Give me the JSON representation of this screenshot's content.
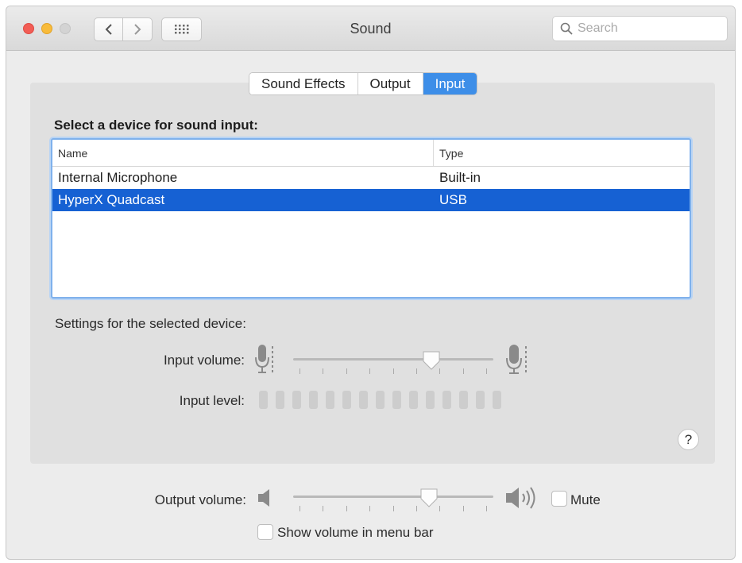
{
  "window": {
    "title": "Sound"
  },
  "search": {
    "placeholder": "Search"
  },
  "tabs": [
    {
      "label": "Sound Effects",
      "active": false
    },
    {
      "label": "Output",
      "active": false
    },
    {
      "label": "Input",
      "active": true
    }
  ],
  "input": {
    "section_title": "Select a device for sound input:",
    "columns": {
      "name": "Name",
      "type": "Type"
    },
    "devices": [
      {
        "name": "Internal Microphone",
        "type": "Built-in",
        "selected": false
      },
      {
        "name": "HyperX Quadcast",
        "type": "USB",
        "selected": true
      }
    ],
    "settings_label": "Settings for the selected device:",
    "volume_label": "Input volume:",
    "volume_value": 0.69,
    "level_label": "Input level:",
    "level_segments": 15,
    "level_active": 0
  },
  "help": {
    "label": "?"
  },
  "output": {
    "volume_label": "Output volume:",
    "volume_value": 0.68,
    "mute_label": "Mute",
    "mute_checked": false,
    "menu_bar_label": "Show volume in menu bar",
    "menu_bar_checked": false
  },
  "colors": {
    "accent": "#3d8ee8",
    "selection": "#1661d3"
  },
  "icons": [
    "back-chevron-icon",
    "forward-chevron-icon",
    "grid-icon",
    "search-icon",
    "microphone-icon",
    "speaker-icon",
    "speaker-loud-icon"
  ]
}
